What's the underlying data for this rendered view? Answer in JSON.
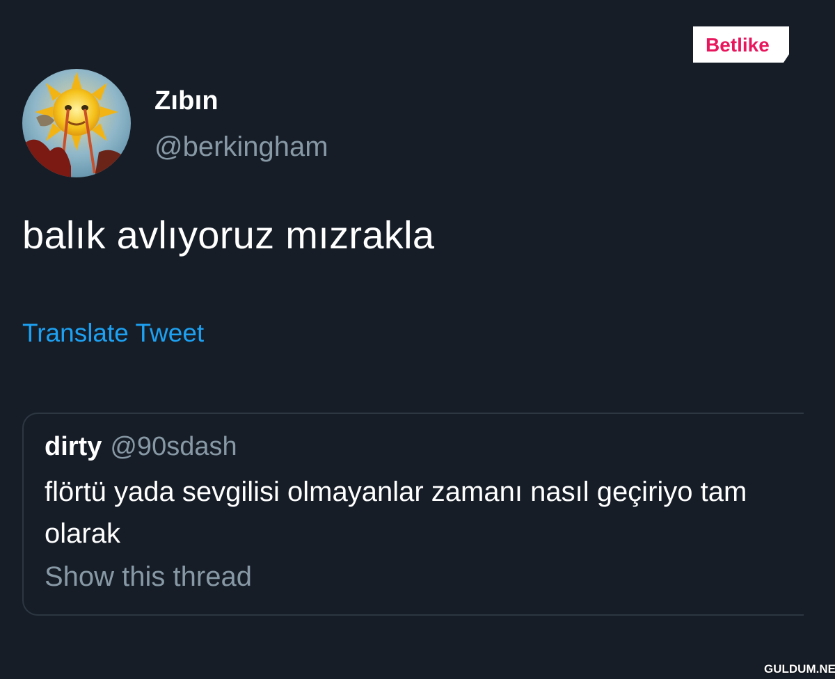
{
  "watermarks": {
    "top_logo_text": "Betlike",
    "bottom_text": "GULDUM.NET"
  },
  "tweet": {
    "display_name": "Zıbın",
    "handle": "@berkingham",
    "text": "balık avlıyoruz mızrakla",
    "translate_label": "Translate Tweet"
  },
  "quoted_tweet": {
    "display_name": "dirty",
    "handle": "@90sdash",
    "text": "flörtü yada sevgilisi olmayanlar zamanı nasıl geçiriyo tam olarak",
    "show_thread_label": "Show this thread"
  },
  "colors": {
    "background": "#161d27",
    "link": "#1da1f2",
    "secondary_text": "#8899a6",
    "logo_accent": "#e8175d"
  }
}
